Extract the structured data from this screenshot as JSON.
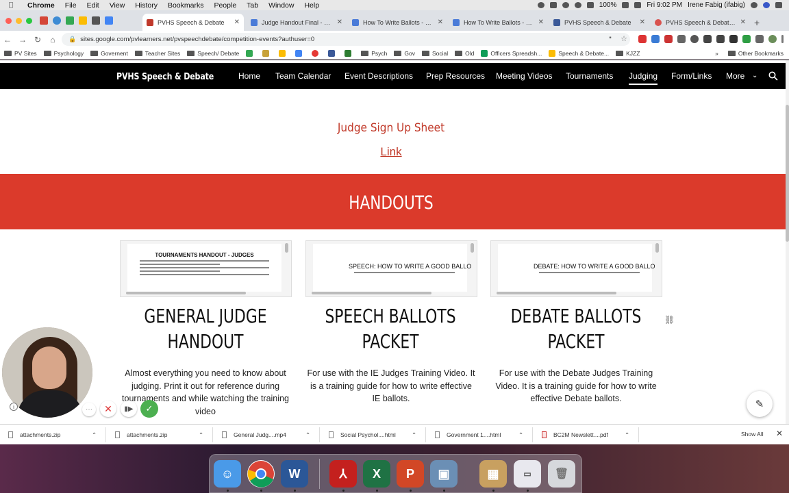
{
  "menubar": {
    "app": "Chrome",
    "items": [
      "File",
      "Edit",
      "View",
      "History",
      "Bookmarks",
      "People",
      "Tab",
      "Window",
      "Help"
    ],
    "battery": "100%",
    "clock": "Fri 9:02 PM",
    "user": "Irene Fabig (ifabig)"
  },
  "tabs": [
    {
      "title": "PVHS Speech & Debate",
      "active": true,
      "color": "#c0392b"
    },
    {
      "title": "Judge Handout Final - Goo",
      "active": false,
      "color": "#4a7bd8"
    },
    {
      "title": "How To Write Ballots - Spe",
      "active": false,
      "color": "#4a7bd8"
    },
    {
      "title": "How To Write Ballots - Deb",
      "active": false,
      "color": "#4a7bd8"
    },
    {
      "title": "PVHS Speech & Debate",
      "active": false,
      "color": "#3b5998"
    },
    {
      "title": "PVHS Speech & Debate - C",
      "active": false,
      "color": "#d9534f"
    }
  ],
  "address": {
    "url": "sites.google.com/pvlearners.net/pvspeechdebate/competition-events?authuser=0"
  },
  "bookmarks": {
    "items": [
      "PV Sites",
      "Psychology",
      "Governent",
      "Teacher Sites",
      "Speech/ Debate",
      "Psych",
      "Gov",
      "Social",
      "Old",
      "Officers Spreadsh...",
      "Speech & Debate...",
      "KJZZ"
    ],
    "more": "»",
    "other": "Other Bookmarks"
  },
  "site": {
    "name": "PVHS Speech & Debate",
    "nav": [
      "Home",
      "Team Calendar",
      "Event Descriptions",
      "Prep Resources",
      "Meeting Videos",
      "Tournaments",
      "Judging",
      "Form/Links",
      "More"
    ],
    "current": "Judging"
  },
  "signup": {
    "heading": "Judge Sign Up Sheet",
    "link": "Link"
  },
  "banner": {
    "title": "HANDOUTS"
  },
  "cards": [
    {
      "thumb_title": "TOURNAMENTS HANDOUT - JUDGES",
      "title_line1": "GENERAL JUDGE",
      "title_line2": "HANDOUT",
      "desc": "Almost everything you need to know about judging.  Print it out for reference during tournaments and while watching the training video"
    },
    {
      "thumb_title": "SPEECH: HOW TO WRITE A GOOD BALLO",
      "title_line1": "SPEECH BALLOTS",
      "title_line2": "PACKET",
      "desc": "For use with the IE Judges Training Video.  It is a training guide for how to write effective IE ballots."
    },
    {
      "thumb_title": "DEBATE: HOW TO WRITE A GOOD BALLO",
      "title_line1": "DEBATE BALLOTS",
      "title_line2": "PACKET",
      "desc": "For use with the Debate Judges Training Video.  It is a training guide for how to write effective Debate ballots."
    }
  ],
  "downloads": {
    "items": [
      "attachments.zip",
      "attachments.zip",
      "General Judg....mp4",
      "Social Psychol....html",
      "Government 1....html",
      "BC2M Newslett....pdf"
    ],
    "show_all": "Show All"
  },
  "dock": {
    "apps": [
      "finder-icon",
      "chrome-icon",
      "word-icon",
      "acrobat-icon",
      "excel-icon",
      "powerpoint-icon",
      "preview-icon",
      "archive-icon",
      "screenshot-icon",
      "trash-icon"
    ]
  }
}
